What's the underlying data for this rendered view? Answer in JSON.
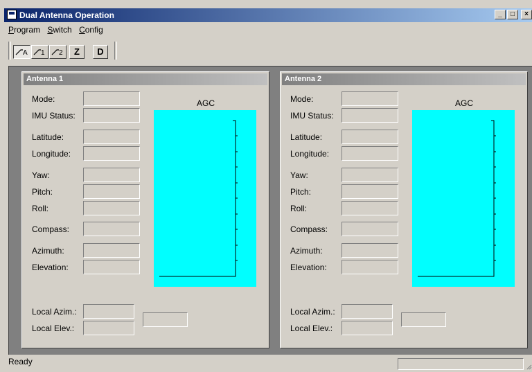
{
  "window": {
    "title": "Dual Antenna Operation"
  },
  "caption_buttons": {
    "minimize": "_",
    "maximize": "□",
    "close": "×"
  },
  "menu": [
    {
      "label": "Program",
      "accel": "P",
      "rest": "rogram"
    },
    {
      "label": "Switch",
      "accel": "S",
      "rest": "witch"
    },
    {
      "label": "Config",
      "accel": "C",
      "rest": "onfig"
    }
  ],
  "toolbar": {
    "buttons": [
      {
        "name": "mode-a",
        "sub": "A",
        "icon": "slope-icon",
        "pressed": true
      },
      {
        "name": "mode-1",
        "sub": "1",
        "icon": "slope-icon",
        "pressed": false
      },
      {
        "name": "mode-2",
        "sub": "2",
        "icon": "slope-icon",
        "pressed": false
      },
      {
        "name": "z",
        "label": "Z",
        "pressed": false
      },
      {
        "name": "d",
        "label": "D",
        "pressed": false
      }
    ]
  },
  "antennas": [
    {
      "title": "Antenna 1",
      "agc_label": "AGC",
      "fields": {
        "mode": "Mode:",
        "imu_status": "IMU Status:",
        "latitude": "Latitude:",
        "longitude": "Longitude:",
        "yaw": "Yaw:",
        "pitch": "Pitch:",
        "roll": "Roll:",
        "compass": "Compass:",
        "azimuth": "Azimuth:",
        "elevation": "Elevation:",
        "local_azim": "Local Azim.:",
        "local_elev": "Local Elev.:"
      }
    },
    {
      "title": "Antenna 2",
      "agc_label": "AGC",
      "fields": {
        "mode": "Mode:",
        "imu_status": "IMU Status:",
        "latitude": "Latitude:",
        "longitude": "Longitude:",
        "yaw": "Yaw:",
        "pitch": "Pitch:",
        "roll": "Roll:",
        "compass": "Compass:",
        "azimuth": "Azimuth:",
        "elevation": "Elevation:",
        "local_azim": "Local Azim.:",
        "local_elev": "Local Elev.:"
      }
    }
  ],
  "status_bar": {
    "text": "Ready"
  },
  "colors": {
    "agc_background": "#00ffff",
    "title_gradient_start": "#0a246a",
    "title_gradient_end": "#a6caf0"
  }
}
